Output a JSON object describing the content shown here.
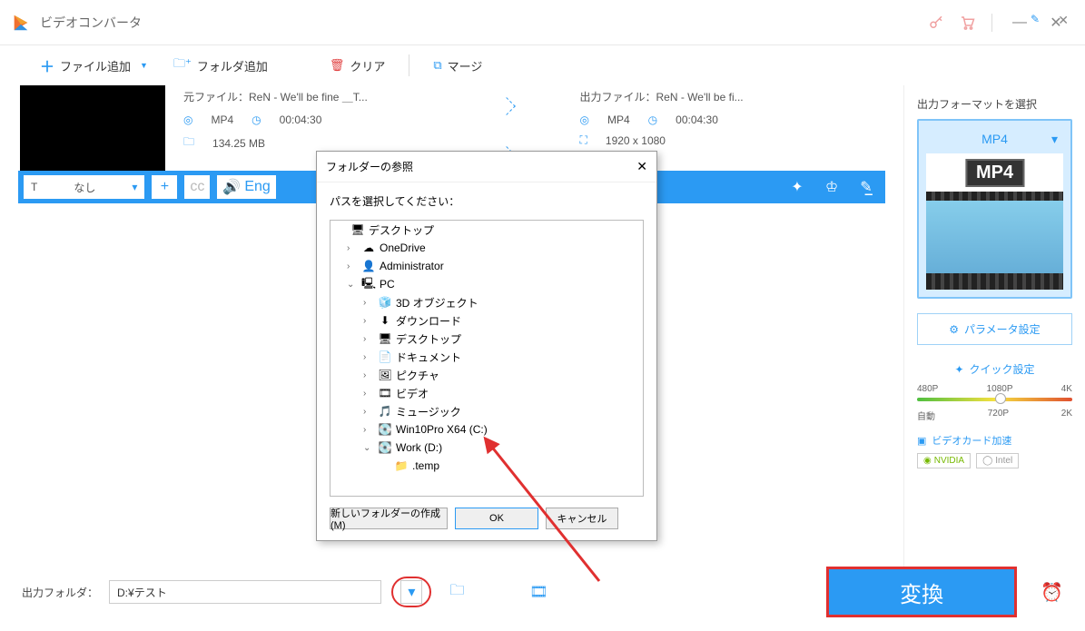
{
  "app": {
    "title": "ビデオコンバータ"
  },
  "toolbar": {
    "addFile": "ファイル追加",
    "addFolder": "フォルダ追加",
    "clear": "クリア",
    "merge": "マージ"
  },
  "file": {
    "srcLabel": "元ファイル：",
    "srcName": "ReN - We'll be fine ＿T...",
    "outLabel": "出力ファイル：",
    "outName": "ReN - We'll be fi...",
    "srcFormat": "MP4",
    "srcDuration": "00:04:30",
    "srcSize": "134.25 MB",
    "outFormat": "MP4",
    "outDuration": "00:04:30",
    "outRes": "1920 x 1080"
  },
  "bluebar": {
    "subtitle": "なし",
    "addLabel": "+",
    "audioLang": "Eng"
  },
  "rightPanel": {
    "selectFormat": "出力フォーマットを選択",
    "currentFormat": "MP4",
    "formatBadge": "MP4",
    "paramBtn": "パラメータ設定",
    "quickTitle": "クイック設定",
    "res": [
      "480P",
      "1080P",
      "4K",
      "自動",
      "720P",
      "2K"
    ],
    "gpuTitle": "ビデオカード加速",
    "nvidia": "NVIDIA",
    "intel": "Intel"
  },
  "bottom": {
    "outFolderLabel": "出力フォルダ：",
    "outFolderPath": "D:¥テスト",
    "convert": "変換"
  },
  "dialog": {
    "title": "フォルダーの参照",
    "instruction": "パスを選択してください：",
    "tree": [
      {
        "lvl": 0,
        "exp": "",
        "icon": "desktop",
        "label": "デスクトップ"
      },
      {
        "lvl": 1,
        "exp": ">",
        "icon": "cloud",
        "label": "OneDrive"
      },
      {
        "lvl": 1,
        "exp": ">",
        "icon": "user",
        "label": "Administrator"
      },
      {
        "lvl": 1,
        "exp": "v",
        "icon": "pc",
        "label": "PC"
      },
      {
        "lvl": 2,
        "exp": ">",
        "icon": "cube",
        "label": "3D オブジェクト"
      },
      {
        "lvl": 2,
        "exp": ">",
        "icon": "down",
        "label": "ダウンロード"
      },
      {
        "lvl": 2,
        "exp": ">",
        "icon": "desktop",
        "label": "デスクトップ"
      },
      {
        "lvl": 2,
        "exp": ">",
        "icon": "doc",
        "label": "ドキュメント"
      },
      {
        "lvl": 2,
        "exp": ">",
        "icon": "pic",
        "label": "ピクチャ"
      },
      {
        "lvl": 2,
        "exp": ">",
        "icon": "video",
        "label": "ビデオ"
      },
      {
        "lvl": 2,
        "exp": ">",
        "icon": "music",
        "label": "ミュージック"
      },
      {
        "lvl": 2,
        "exp": ">",
        "icon": "drive",
        "label": "Win10Pro X64 (C:)"
      },
      {
        "lvl": 2,
        "exp": "v",
        "icon": "drive",
        "label": "Work (D:)"
      },
      {
        "lvl": 3,
        "exp": "",
        "icon": "folder",
        "label": ".temp"
      }
    ],
    "makeFolder": "新しいフォルダーの作成(M)",
    "ok": "OK",
    "cancel": "キャンセル"
  }
}
